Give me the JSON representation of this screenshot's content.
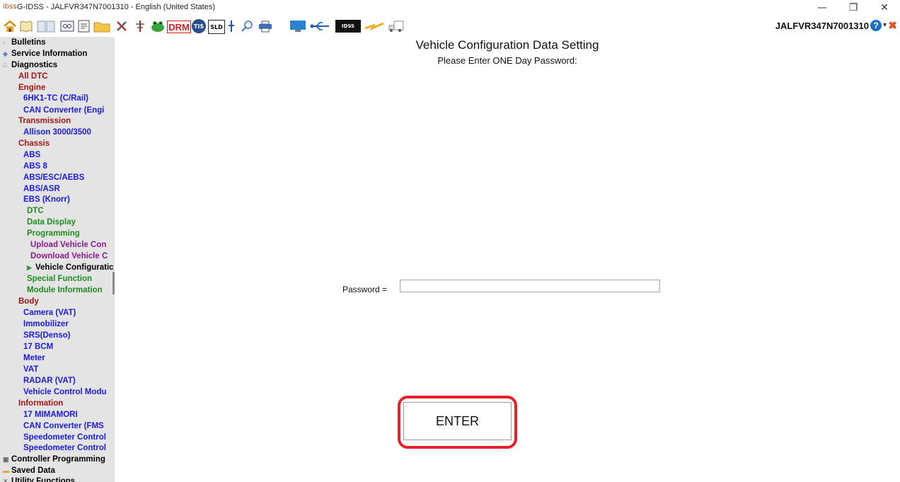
{
  "window": {
    "app_icon": "ibss",
    "title": "G-IDSS - JALFVR347N7001310 - English (United States)",
    "minimize_glyph": "—",
    "restore_glyph": "❐",
    "close_glyph": "✕"
  },
  "toolbar": {
    "vin": "JALFVR347N7001310",
    "drm_label": "DRM",
    "tis_label": "TIS",
    "sld_label": "SLD",
    "idss_label": "IDSS",
    "help_glyph": "?",
    "help_dropdown": "▾",
    "exit_glyph": "✖",
    "icons": [
      "home-icon",
      "book-icon",
      "book-icon",
      "connector-icon",
      "document-icon",
      "folder-icon",
      "tools-icon",
      "probe-icon",
      "frog-icon",
      "drm-icon",
      "tis-icon",
      "sld-icon",
      "pin-icon",
      "search-icon",
      "print-icon",
      "monitor-icon",
      "usb-icon",
      "idss-device-icon",
      "lightning-icon",
      "truck-icon"
    ]
  },
  "sidebar": {
    "items": [
      {
        "label": "Bulletins",
        "color": "#000000",
        "icon": "bulletin-icon"
      },
      {
        "label": "Service Information",
        "color": "#000000",
        "icon": "info-icon"
      },
      {
        "label": "Diagnostics",
        "color": "#000000",
        "icon": "diagnostics-icon"
      },
      {
        "label": "All DTC",
        "color": "#a31515"
      },
      {
        "label": "Engine",
        "color": "#a31515"
      },
      {
        "label": "6HK1-TC (C/Rail)",
        "color": "#1a1adc"
      },
      {
        "label": "CAN Converter (Engi",
        "color": "#1a1adc"
      },
      {
        "label": "Transmission",
        "color": "#a31515"
      },
      {
        "label": "Allison 3000/3500",
        "color": "#1a1adc"
      },
      {
        "label": "Chassis",
        "color": "#a31515"
      },
      {
        "label": "ABS",
        "color": "#1a1adc"
      },
      {
        "label": "ABS 8",
        "color": "#1a1adc"
      },
      {
        "label": "ABS/ESC/AEBS",
        "color": "#1a1adc"
      },
      {
        "label": "ABS/ASR",
        "color": "#1a1adc"
      },
      {
        "label": "EBS (Knorr)",
        "color": "#1a1adc"
      },
      {
        "label": "DTC",
        "color": "#1e8c1e"
      },
      {
        "label": "Data Display",
        "color": "#1e8c1e"
      },
      {
        "label": "Programming",
        "color": "#1e8c1e"
      },
      {
        "label": "Upload Vehicle Con",
        "color": "#8b1a8b"
      },
      {
        "label": "Download Vehicle C",
        "color": "#8b1a8b"
      },
      {
        "label": "Vehicle Configuratic",
        "color": "#000000",
        "icon": "selected-arrow-icon"
      },
      {
        "label": "Special Function",
        "color": "#1e8c1e"
      },
      {
        "label": "Module Information",
        "color": "#1e8c1e"
      },
      {
        "label": "Body",
        "color": "#a31515"
      },
      {
        "label": "Camera (VAT)",
        "color": "#1a1adc"
      },
      {
        "label": "Immobilizer",
        "color": "#1a1adc"
      },
      {
        "label": "SRS(Denso)",
        "color": "#1a1adc"
      },
      {
        "label": "17 BCM",
        "color": "#1a1adc"
      },
      {
        "label": "Meter",
        "color": "#1a1adc"
      },
      {
        "label": "VAT",
        "color": "#1a1adc"
      },
      {
        "label": "RADAR (VAT)",
        "color": "#1a1adc"
      },
      {
        "label": "Vehicle Control Modu",
        "color": "#1a1adc"
      },
      {
        "label": "Information",
        "color": "#a31515"
      },
      {
        "label": "17 MIMAMORI",
        "color": "#1a1adc"
      },
      {
        "label": "CAN Converter (FMS",
        "color": "#1a1adc"
      },
      {
        "label": "Speedometer Control",
        "color": "#1a1adc"
      },
      {
        "label": "Speedometer Control",
        "color": "#1a1adc"
      },
      {
        "label": "Controller Programming",
        "color": "#000000",
        "icon": "controller-icon"
      },
      {
        "label": "Saved Data",
        "color": "#000000",
        "icon": "folder-icon"
      },
      {
        "label": "Utility Functions",
        "color": "#000000",
        "icon": "wrench-icon"
      }
    ]
  },
  "main": {
    "title": "Vehicle Configuration Data Setting",
    "subtitle": "Please Enter ONE Day Password:",
    "password_label": "Password =",
    "password_value": "",
    "enter_label": "ENTER"
  },
  "colors": {
    "highlight": "#e8202a",
    "sidebar_bg": "#e4e4e4"
  }
}
